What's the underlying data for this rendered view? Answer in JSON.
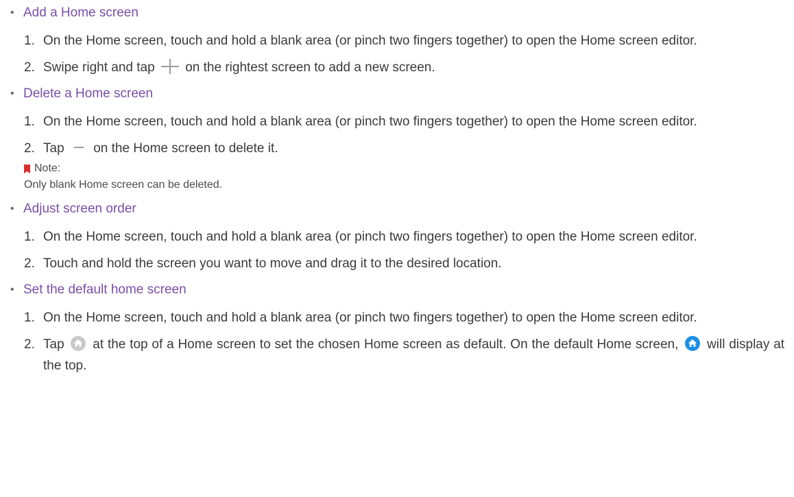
{
  "sections": [
    {
      "title": "Add a Home screen",
      "step1": {
        "num": "1.",
        "text": "On the Home screen, touch and hold a blank area (or pinch two fingers together) to open the Home screen editor."
      },
      "step2": {
        "num": "2.",
        "before": "Swipe right and tap",
        "after": "on the rightest screen to add a new screen.",
        "icon": "plus-icon"
      }
    },
    {
      "title": "Delete a Home screen",
      "step1": {
        "num": "1.",
        "text": "On the Home screen, touch and hold a blank area (or pinch two fingers together) to open the Home screen editor."
      },
      "step2": {
        "num": "2.",
        "before": "Tap",
        "after": "on the Home screen to delete it.",
        "icon": "minus-icon"
      },
      "note": {
        "title": "Note:",
        "text": "Only blank Home screen can be deleted.",
        "icon": "bookmark-icon"
      }
    },
    {
      "title": "Adjust screen order",
      "step1": {
        "num": "1.",
        "text": "On the Home screen, touch and hold a blank area (or pinch two fingers together) to open the Home screen editor."
      },
      "step2": {
        "num": "2.",
        "text": "Touch and hold the screen you want to move and drag it to the desired location."
      }
    },
    {
      "title": "Set the default home screen",
      "step1": {
        "num": "1.",
        "text": "On the Home screen, touch and hold a blank area (or pinch two fingers together) to open the Home screen editor."
      },
      "step2": {
        "num": "2.",
        "before": "Tap",
        "middle": "at the top of a Home screen to set the chosen Home screen as default. On the default Home screen,",
        "after": "will display at the top.",
        "icons": [
          "home-grey-icon",
          "home-blue-icon"
        ]
      }
    }
  ],
  "colors": {
    "heading": "#7a4ea8",
    "body": "#3a3a3a",
    "icon_grey": "#c9c9c9",
    "icon_blue": "#1f8fe6",
    "note_mark": "#d9302b"
  },
  "bullet": "•"
}
